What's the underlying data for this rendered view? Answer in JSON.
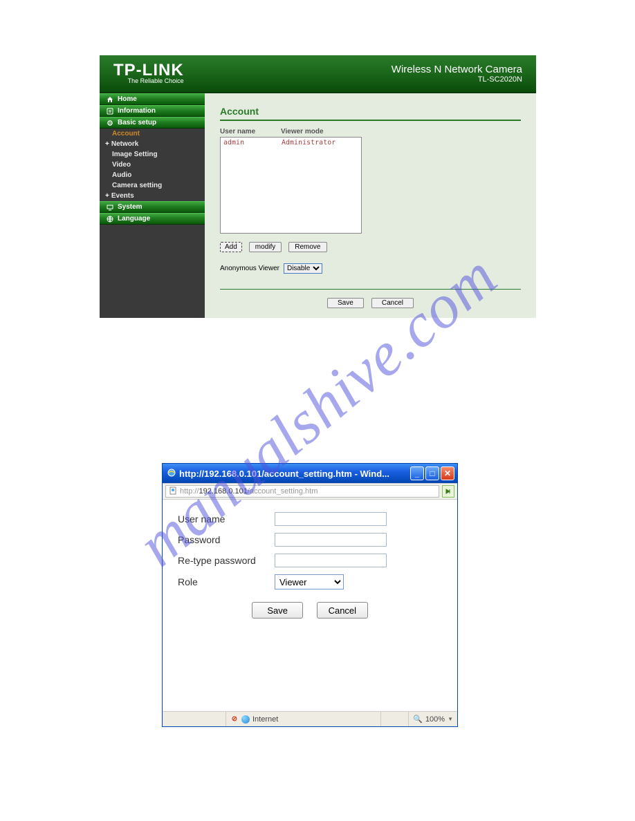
{
  "watermark": "manualshive.com",
  "router": {
    "brand": "TP-LINK",
    "tagline": "The Reliable Choice",
    "product_name": "Wireless N Network Camera",
    "product_model": "TL-SC2020N",
    "sidebar": {
      "home": "Home",
      "information": "Information",
      "basic_setup": "Basic setup",
      "account": "Account",
      "network": "Network",
      "image_setting": "Image Setting",
      "video": "Video",
      "audio": "Audio",
      "camera_setting": "Camera setting",
      "events": "Events",
      "system": "System",
      "language": "Language"
    },
    "page": {
      "title": "Account",
      "col_user": "User name",
      "col_mode": "Viewer mode",
      "rows": [
        {
          "user": "admin",
          "mode": "Administrator"
        }
      ],
      "btn_add": "Add",
      "btn_modify": "modify",
      "btn_remove": "Remove",
      "anon_label": "Anonymous Viewer",
      "anon_value": "Disable",
      "btn_save": "Save",
      "btn_cancel": "Cancel"
    }
  },
  "popup": {
    "title": "http://192.168.0.101/account_setting.htm - Wind...",
    "url_proto": "http://",
    "url_domain": "192.168.0.101",
    "url_path": "/account_setting.htm",
    "form": {
      "user_label": "User name",
      "pass_label": "Password",
      "repass_label": "Re-type password",
      "role_label": "Role",
      "role_value": "Viewer",
      "btn_save": "Save",
      "btn_cancel": "Cancel"
    },
    "status": {
      "zone": "Internet",
      "zoom": "100%"
    }
  }
}
